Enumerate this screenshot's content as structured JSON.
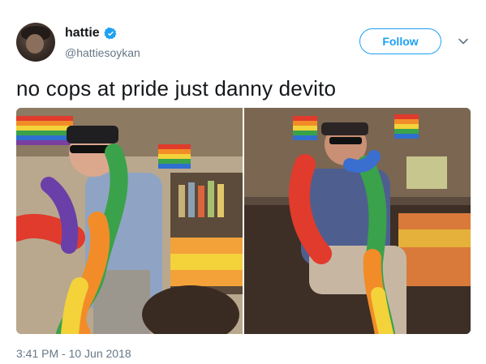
{
  "author": {
    "display_name": "hattie",
    "handle": "@hattiesoykan",
    "verified_icon": "verified-badge-icon",
    "avatar": "avatar"
  },
  "actions": {
    "follow_label": "Follow",
    "menu_icon": "chevron-down-icon"
  },
  "tweet": {
    "text": "no cops at pride just danny devito",
    "timestamp": "3:41 PM - 10 Jun 2018"
  },
  "media": [
    {
      "name": "photo-left",
      "description_icon": "photo"
    },
    {
      "name": "photo-right",
      "description_icon": "photo"
    }
  ],
  "colors": {
    "accent": "#1da1f2",
    "text_primary": "#14171a",
    "text_secondary": "#657786"
  }
}
